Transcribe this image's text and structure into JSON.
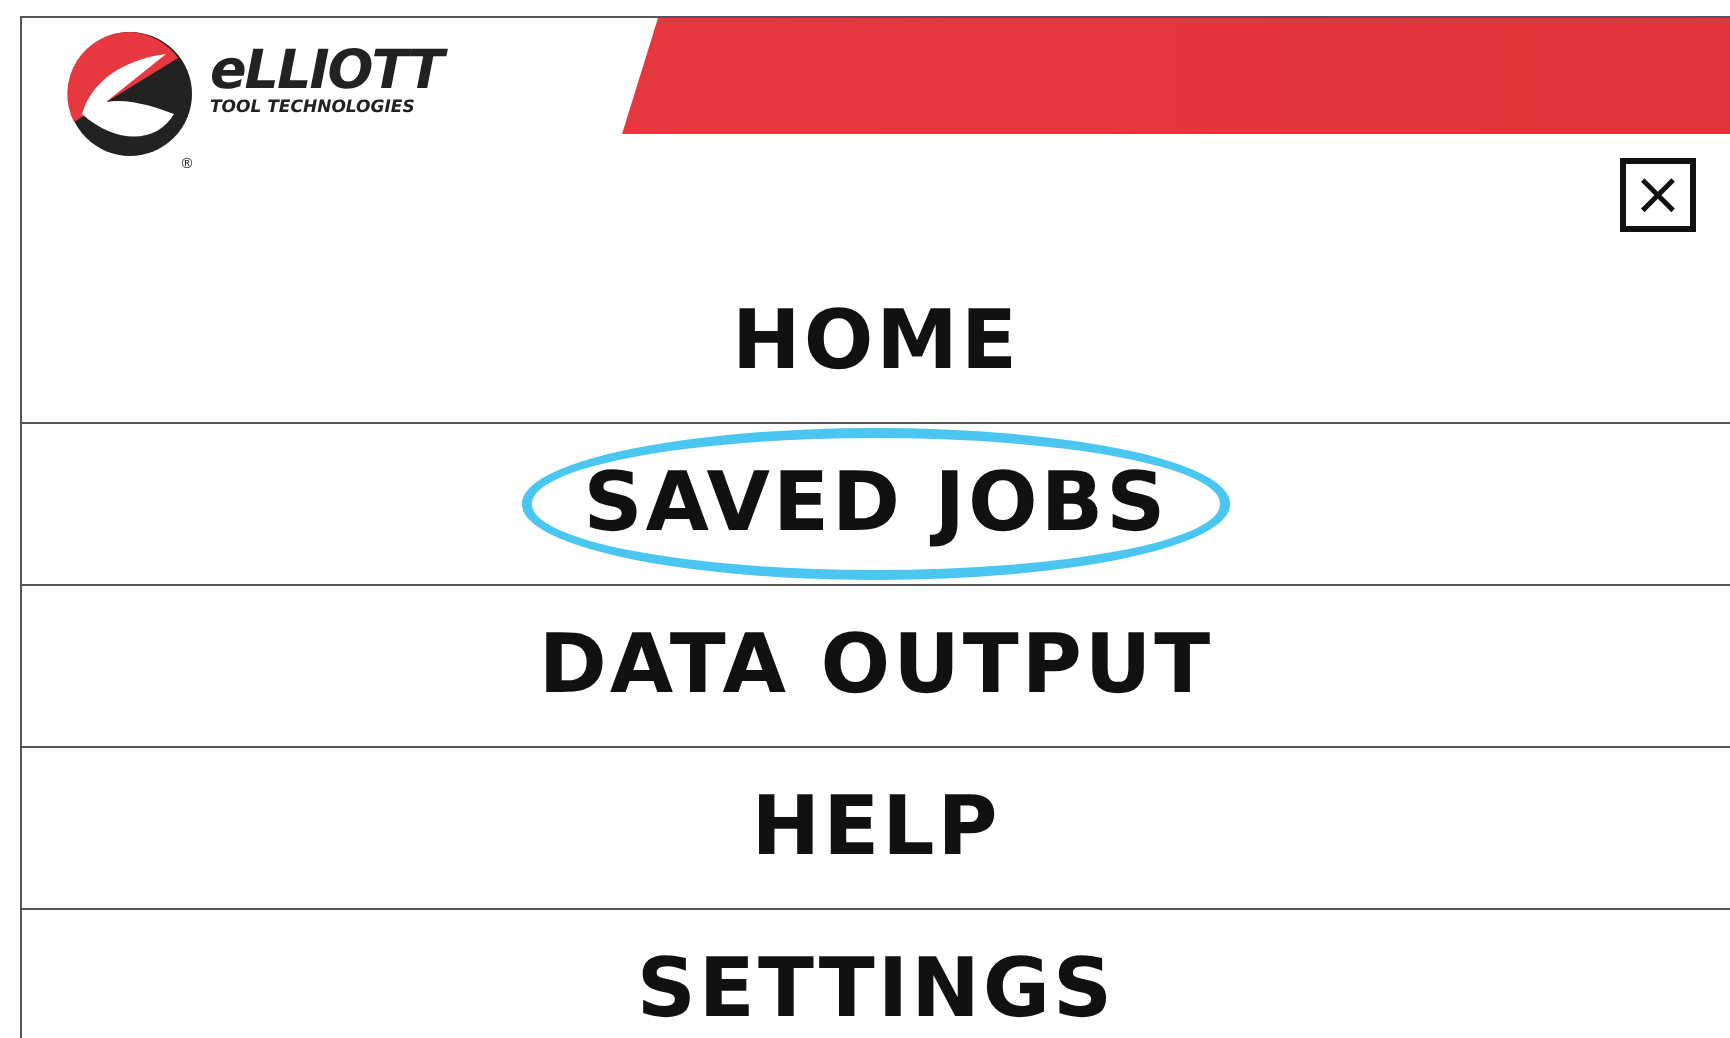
{
  "logo": {
    "name": "eLLIOTT",
    "tagline": "TOOL TECHNOLOGIES",
    "mark": "®"
  },
  "close_button": {
    "label": "×"
  },
  "menu": [
    {
      "label": "HOME",
      "highlighted": false
    },
    {
      "label": "SAVED JOBS",
      "highlighted": true
    },
    {
      "label": "DATA OUTPUT",
      "highlighted": false
    },
    {
      "label": "HELP",
      "highlighted": false
    },
    {
      "label": "SETTINGS",
      "highlighted": false
    }
  ]
}
